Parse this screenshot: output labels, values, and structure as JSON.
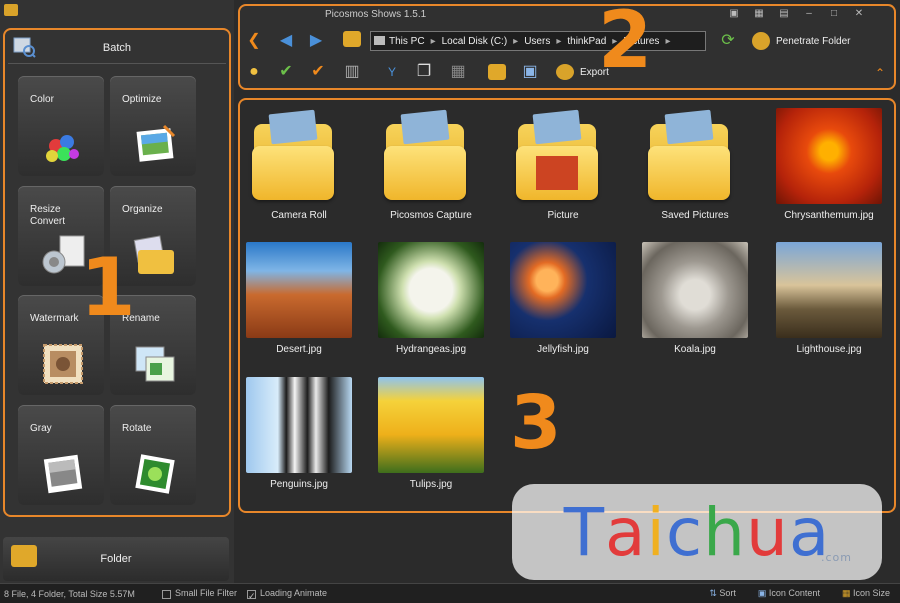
{
  "window": {
    "title": "Picosmos Shows 1.5.1"
  },
  "left_panel": {
    "batch_label": "Batch",
    "tools": [
      {
        "label": "Color",
        "icon": "color-circles-icon"
      },
      {
        "label": "Optimize",
        "icon": "optimize-photo-icon"
      },
      {
        "label": "Resize Convert",
        "icon": "resize-convert-icon"
      },
      {
        "label": "Organize",
        "icon": "organize-folder-icon"
      },
      {
        "label": "Watermark",
        "icon": "watermark-stamp-icon"
      },
      {
        "label": "Rename",
        "icon": "rename-photos-icon"
      },
      {
        "label": "Gray",
        "icon": "gray-photo-icon"
      },
      {
        "label": "Rotate",
        "icon": "rotate-photo-icon"
      }
    ],
    "folder_label": "Folder"
  },
  "annotations": {
    "n1": "1",
    "n2": "2",
    "n3": "3"
  },
  "toolbar": {
    "breadcrumb": [
      "This PC",
      "Local Disk (C:)",
      "Users",
      "thinkPad",
      "Pictures"
    ],
    "penetrate_label": "Penetrate Folder",
    "export_label": "Export"
  },
  "content": {
    "items": [
      {
        "name": "Camera Roll",
        "kind": "folder"
      },
      {
        "name": "Picosmos Capture",
        "kind": "folder"
      },
      {
        "name": "Picture",
        "kind": "folder-photo"
      },
      {
        "name": "Saved Pictures",
        "kind": "folder"
      },
      {
        "name": "Chrysanthemum.jpg",
        "kind": "image"
      },
      {
        "name": "Desert.jpg",
        "kind": "image"
      },
      {
        "name": "Hydrangeas.jpg",
        "kind": "image"
      },
      {
        "name": "Jellyfish.jpg",
        "kind": "image"
      },
      {
        "name": "Koala.jpg",
        "kind": "image"
      },
      {
        "name": "Lighthouse.jpg",
        "kind": "image"
      },
      {
        "name": "Penguins.jpg",
        "kind": "image"
      },
      {
        "name": "Tulips.jpg",
        "kind": "image"
      }
    ]
  },
  "status": {
    "summary": "8 File, 4 Folder, Total Size 5.57M",
    "small_file_filter": "Small File Filter",
    "loading_animate": "Loading Animate",
    "sort": "Sort",
    "icon_content": "Icon Content",
    "icon_size": "Icon Size"
  },
  "watermark": {
    "brand": "Taichua",
    "suffix": ".com"
  },
  "colors": {
    "accent": "#e8872a",
    "folder": "#f0b62b",
    "panel": "#333333"
  }
}
